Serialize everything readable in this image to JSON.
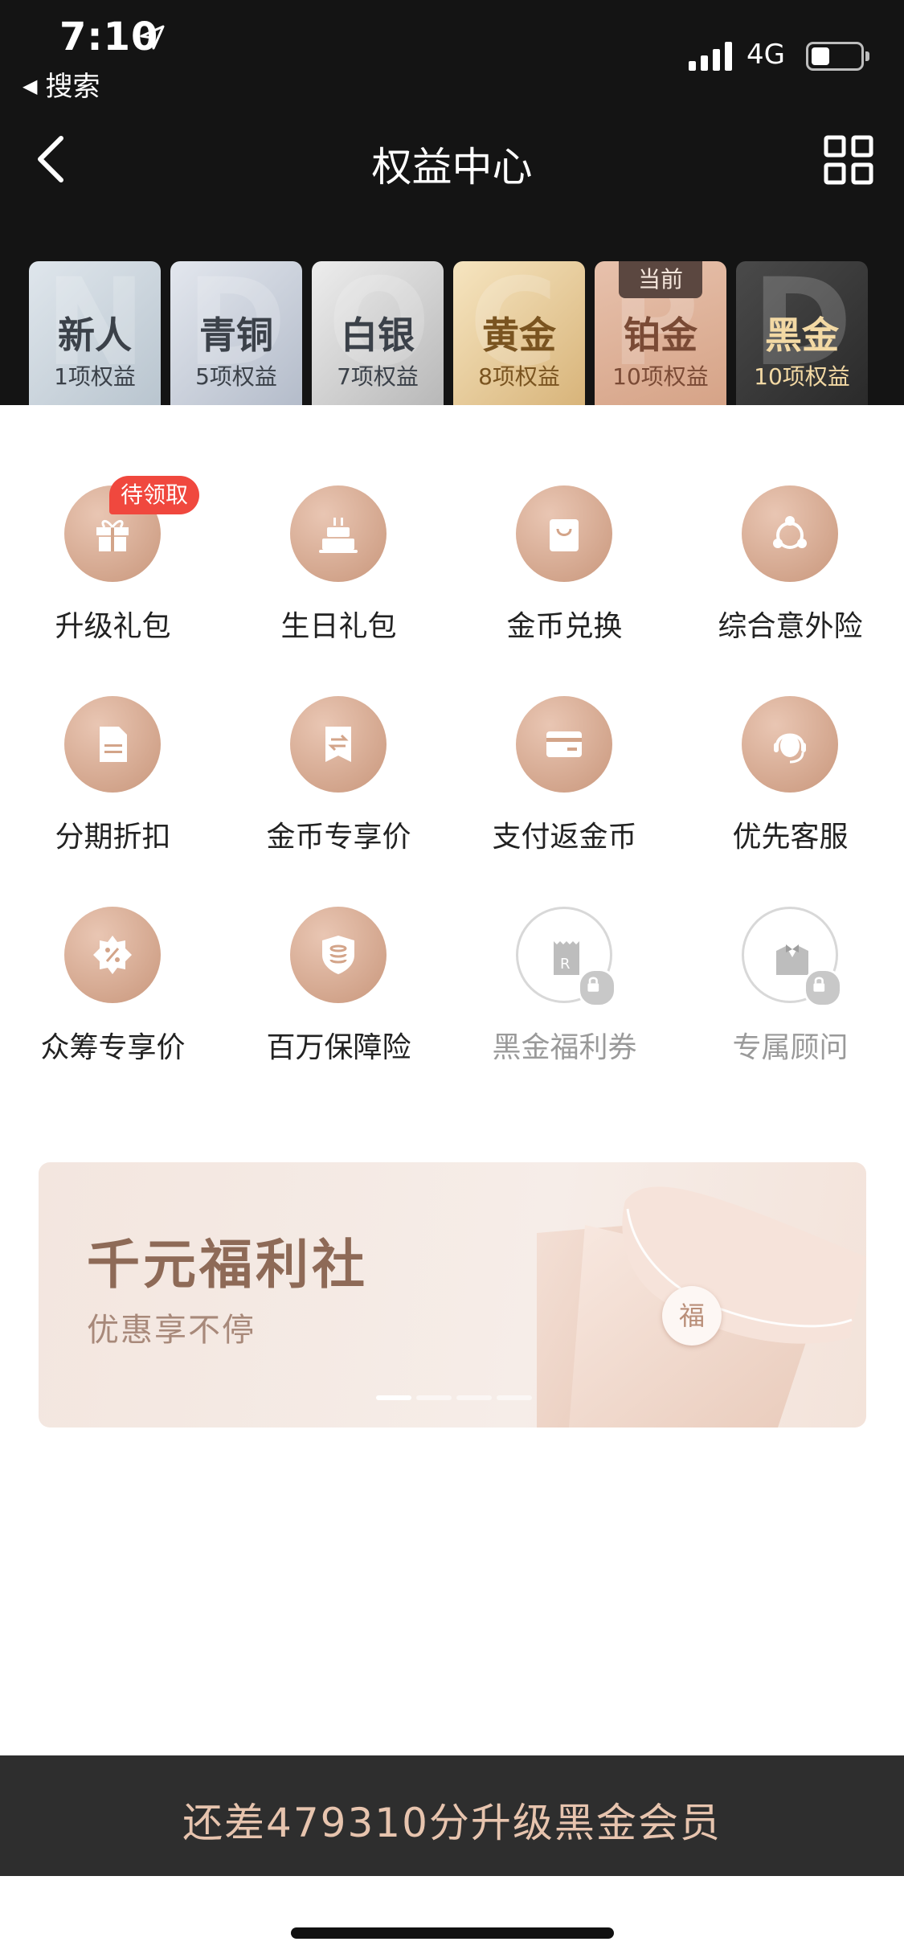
{
  "status": {
    "time": "7:10",
    "back_app": "搜索",
    "network": "4G"
  },
  "nav": {
    "title": "权益中心"
  },
  "tiers": [
    {
      "ghost": "N",
      "name": "新人",
      "count": "1项权益"
    },
    {
      "ghost": "D",
      "name": "青铜",
      "count": "5项权益"
    },
    {
      "ghost": "O",
      "name": "白银",
      "count": "7项权益"
    },
    {
      "ghost": "C",
      "name": "黄金",
      "count": "8项权益"
    },
    {
      "ghost": "P",
      "name": "铂金",
      "count": "10项权益",
      "tag": "当前"
    },
    {
      "ghost": "D",
      "name": "黑金",
      "count": "10项权益"
    }
  ],
  "benefits": [
    {
      "label": "升级礼包",
      "icon": "gift-icon",
      "badge": "待领取"
    },
    {
      "label": "生日礼包",
      "icon": "cake-icon"
    },
    {
      "label": "金币兑换",
      "icon": "shopping-bag-icon"
    },
    {
      "label": "综合意外险",
      "icon": "shield-network-icon"
    },
    {
      "label": "分期折扣",
      "icon": "document-icon"
    },
    {
      "label": "金币专享价",
      "icon": "exchange-tag-icon"
    },
    {
      "label": "支付返金币",
      "icon": "card-icon"
    },
    {
      "label": "优先客服",
      "icon": "headset-icon"
    },
    {
      "label": "众筹专享价",
      "icon": "percent-badge-icon"
    },
    {
      "label": "百万保障险",
      "icon": "insurance-icon"
    },
    {
      "label": "黑金福利券",
      "icon": "ticket-icon",
      "locked": true
    },
    {
      "label": "专属顾问",
      "icon": "butler-icon",
      "locked": true
    }
  ],
  "banner": {
    "title": "千元福利社",
    "subtitle": "优惠享不停",
    "envelope_char": "福",
    "slides": 4,
    "active_slide": 1
  },
  "bottom_bar": {
    "text": "还差479310分升级黑金会员"
  },
  "colors": {
    "header_bg": "#141414",
    "accent_rose": "#c9977c",
    "badge_red": "#f0483e",
    "bottom_bar_bg": "#2e2e2e",
    "bottom_bar_text": "#e7c4ae"
  }
}
